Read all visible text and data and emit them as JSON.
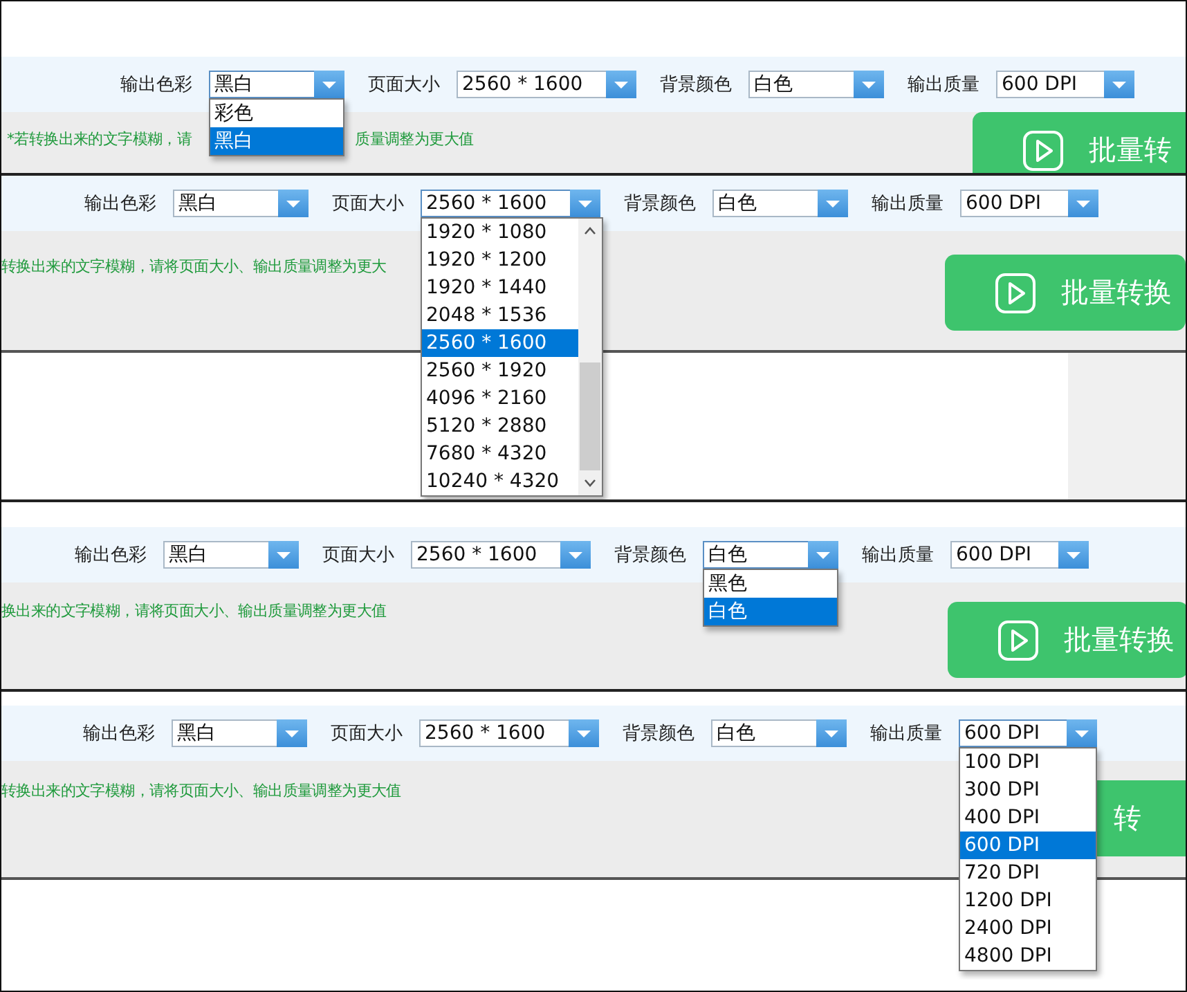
{
  "panels": [
    {
      "fields": [
        {
          "label": "输出色彩",
          "value": "黑白",
          "open": true,
          "scrollable": false,
          "options": [
            {
              "label": "彩色",
              "selected": false
            },
            {
              "label": "黑白",
              "selected": true
            }
          ]
        },
        {
          "label": "页面大小",
          "value": "2560 * 1600",
          "open": false
        },
        {
          "label": "背景颜色",
          "value": "白色",
          "open": false
        },
        {
          "label": "输出质量",
          "value": "600 DPI",
          "open": false
        }
      ],
      "hint_parts": [
        "*若转换出来的文字模糊，请",
        "质量调整为更大值"
      ],
      "button": {
        "label": "批量转",
        "icon": true
      }
    },
    {
      "fields": [
        {
          "label": "输出色彩",
          "value": "黑白",
          "open": false
        },
        {
          "label": "页面大小",
          "value": "2560 * 1600",
          "open": true,
          "scrollable": true,
          "options": [
            {
              "label": "1920 * 1080",
              "selected": false
            },
            {
              "label": "1920 * 1200",
              "selected": false
            },
            {
              "label": "1920 * 1440",
              "selected": false
            },
            {
              "label": "2048 * 1536",
              "selected": false
            },
            {
              "label": "2560 * 1600",
              "selected": true
            },
            {
              "label": "2560 * 1920",
              "selected": false
            },
            {
              "label": "4096 * 2160",
              "selected": false
            },
            {
              "label": "5120 * 2880",
              "selected": false
            },
            {
              "label": "7680 * 4320",
              "selected": false
            },
            {
              "label": "10240 * 4320",
              "selected": false
            }
          ]
        },
        {
          "label": "背景颜色",
          "value": "白色",
          "open": false
        },
        {
          "label": "输出质量",
          "value": "600 DPI",
          "open": false
        }
      ],
      "hint_parts": [
        "转换出来的文字模糊，请将页面大小、输出质量调整为更大"
      ],
      "button": {
        "label": "批量转换",
        "icon": true
      }
    },
    {
      "fields": [
        {
          "label": "输出色彩",
          "value": "黑白",
          "open": false
        },
        {
          "label": "页面大小",
          "value": "2560 * 1600",
          "open": false
        },
        {
          "label": "背景颜色",
          "value": "白色",
          "open": true,
          "scrollable": false,
          "options": [
            {
              "label": "黑色",
              "selected": false
            },
            {
              "label": "白色",
              "selected": true
            }
          ]
        },
        {
          "label": "输出质量",
          "value": "600 DPI",
          "open": false
        }
      ],
      "hint_parts": [
        "换出来的文字模糊，请将页面大小、输出质量调整为更大值"
      ],
      "button": {
        "label": "批量转换",
        "icon": true
      }
    },
    {
      "fields": [
        {
          "label": "输出色彩",
          "value": "黑白",
          "open": false
        },
        {
          "label": "页面大小",
          "value": "2560 * 1600",
          "open": false
        },
        {
          "label": "背景颜色",
          "value": "白色",
          "open": false
        },
        {
          "label": "输出质量",
          "value": "600 DPI",
          "open": true,
          "scrollable": false,
          "options": [
            {
              "label": "100 DPI",
              "selected": false
            },
            {
              "label": "300 DPI",
              "selected": false
            },
            {
              "label": "400 DPI",
              "selected": false
            },
            {
              "label": "600 DPI",
              "selected": true
            },
            {
              "label": "720 DPI",
              "selected": false
            },
            {
              "label": "1200 DPI",
              "selected": false
            },
            {
              "label": "2400 DPI",
              "selected": false
            },
            {
              "label": "4800 DPI",
              "selected": false
            }
          ]
        }
      ],
      "hint_parts": [
        "转换出来的文字模糊，请将页面大小、输出质量调整为更大值"
      ],
      "button": {
        "label": "转",
        "icon": false
      }
    }
  ]
}
